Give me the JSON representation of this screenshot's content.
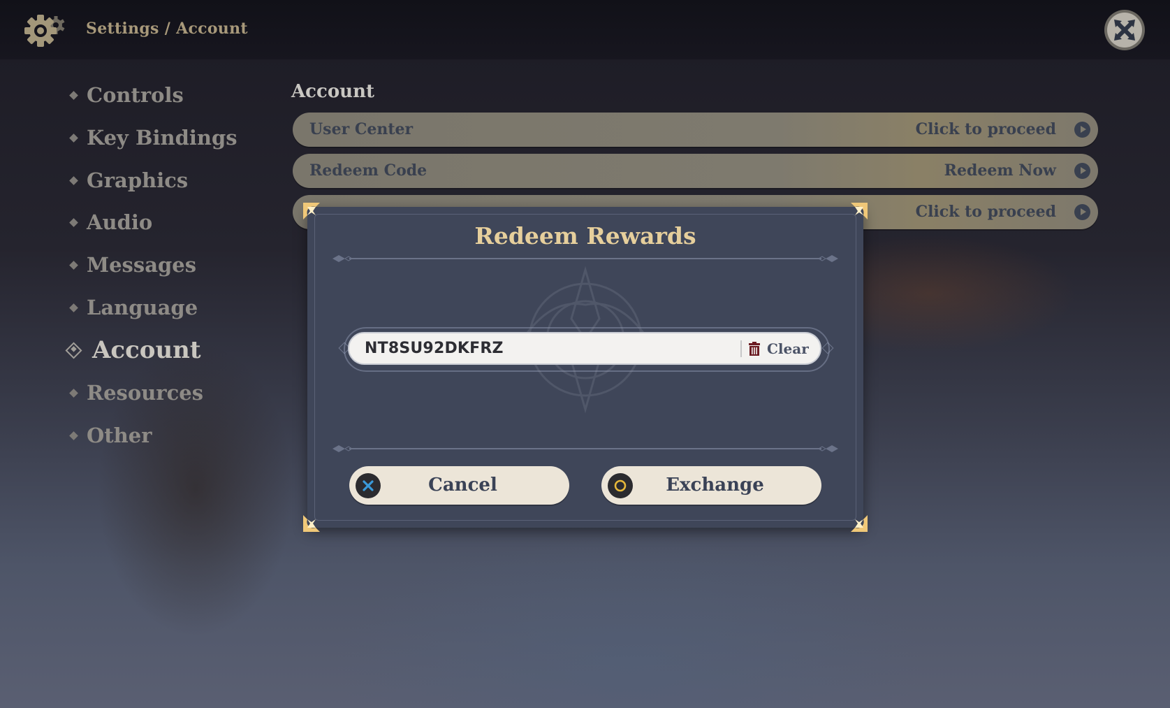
{
  "header": {
    "icon": "gear-icon",
    "breadcrumb": [
      "Settings",
      "Account"
    ],
    "breadcrumb_separator": "/",
    "close_icon": "close-icon"
  },
  "sidebar": {
    "items": [
      {
        "label": "Controls",
        "active": false
      },
      {
        "label": "Key Bindings",
        "active": false
      },
      {
        "label": "Graphics",
        "active": false
      },
      {
        "label": "Audio",
        "active": false
      },
      {
        "label": "Messages",
        "active": false
      },
      {
        "label": "Language",
        "active": false
      },
      {
        "label": "Account",
        "active": true
      },
      {
        "label": "Resources",
        "active": false
      },
      {
        "label": "Other",
        "active": false
      }
    ]
  },
  "main": {
    "section_title": "Account",
    "rows": [
      {
        "label": "User Center",
        "action": "Click to proceed"
      },
      {
        "label": "Redeem Code",
        "action": "Redeem Now"
      },
      {
        "label": "",
        "action": "Click to proceed"
      }
    ]
  },
  "dialog": {
    "title": "Redeem Rewards",
    "code_value": "NT8SU92DKFRZ",
    "clear_label": "Clear",
    "cancel_label": "Cancel",
    "exchange_label": "Exchange",
    "colors": {
      "title": "#e6cf9c",
      "panel": "#3f4659",
      "button": "#ece5d8",
      "cancel_icon": "#3a9ad9",
      "exchange_icon": "#e6b83a",
      "clear_icon": "#6b1b22"
    }
  }
}
